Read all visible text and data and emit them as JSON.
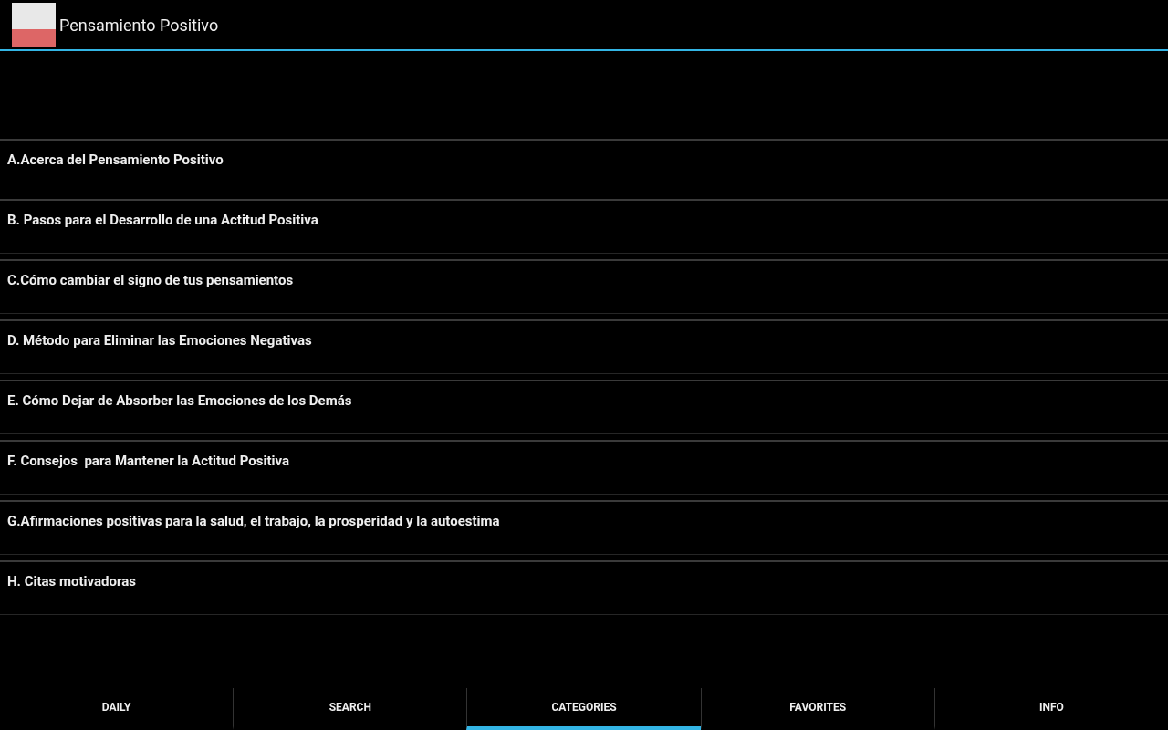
{
  "action_bar": {
    "title": "Pensamiento Positivo"
  },
  "categories": [
    {
      "label": "A.Acerca del Pensamiento Positivo"
    },
    {
      "label": "B. Pasos para el Desarrollo de una Actitud Positiva"
    },
    {
      "label": "C.Cómo cambiar el signo de tus pensamientos"
    },
    {
      "label": "D. Método para Eliminar las Emociones Negativas"
    },
    {
      "label": "E. Cómo Dejar de Absorber las Emociones de los Demás"
    },
    {
      "label": "F. Consejos  para Mantener la Actitud Positiva"
    },
    {
      "label": "G.Afirmaciones positivas para la salud, el trabajo, la prosperidad y la autoestima"
    },
    {
      "label": "H. Citas motivadoras"
    }
  ],
  "tabs": [
    {
      "label": "DAILY",
      "selected": false
    },
    {
      "label": "SEARCH",
      "selected": false
    },
    {
      "label": "CATEGORIES",
      "selected": true
    },
    {
      "label": "FAVORITES",
      "selected": false
    },
    {
      "label": "INFO",
      "selected": false
    }
  ]
}
